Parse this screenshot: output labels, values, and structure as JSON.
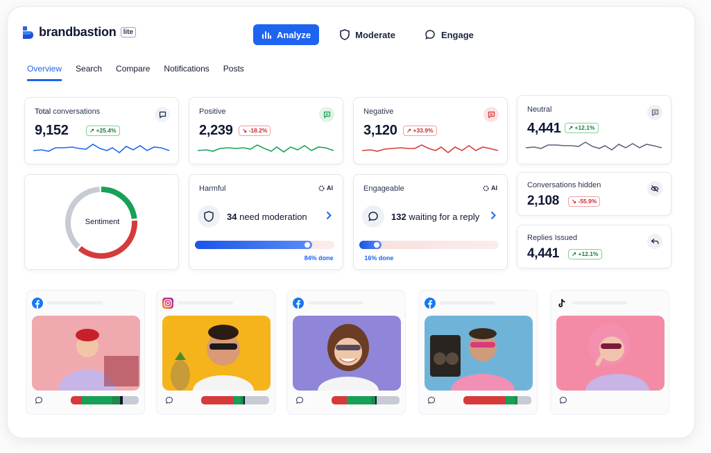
{
  "brand": {
    "name": "brandbastion",
    "badge": "lite"
  },
  "main_nav": [
    {
      "label": "Analyze",
      "active": true,
      "icon": "bar-chart-icon"
    },
    {
      "label": "Moderate",
      "active": false,
      "icon": "shield-icon"
    },
    {
      "label": "Engage",
      "active": false,
      "icon": "chat-bubble-icon"
    }
  ],
  "subtabs": [
    {
      "label": "Overview",
      "active": true
    },
    {
      "label": "Search",
      "active": false
    },
    {
      "label": "Compare",
      "active": false
    },
    {
      "label": "Notifications",
      "active": false
    },
    {
      "label": "Posts",
      "active": false
    }
  ],
  "stats": {
    "total": {
      "title_a": "Total",
      "title_b": "conversations",
      "value": "9,152",
      "delta": "↗ +25.4%"
    },
    "positive": {
      "title": "Positive",
      "value": "2,239",
      "delta": "↘ -18.2%"
    },
    "negative": {
      "title": "Negative",
      "value": "3,120",
      "delta": "↗ +33.9%"
    },
    "neutral": {
      "title": "Neutral",
      "value": "4,441",
      "delta": "↗ +12.1%"
    },
    "hidden": {
      "title": "Conversations hidden",
      "value": "2,108",
      "delta": "↘ -55.9%"
    },
    "replies": {
      "title": "Replies Issued",
      "value": "4,441",
      "delta": "↗ +12.1%"
    }
  },
  "sentiment": {
    "label": "Sentiment",
    "positive_share": 0.24,
    "negative_share": 0.38,
    "neutral_share": 0.38
  },
  "harmful": {
    "title": "Harmful",
    "ai": "AI",
    "count": "34",
    "text": "need moderation",
    "progress": 0.84,
    "done": "84% done"
  },
  "engageable": {
    "title": "Engageable",
    "ai": "AI",
    "count": "132",
    "text": "waiting for a reply",
    "progress": 0.16,
    "done": "16% done"
  },
  "posts": [
    {
      "platform": "facebook-icon",
      "sentiment": [
        0.16,
        0.44,
        0.12,
        0.05,
        0.23
      ]
    },
    {
      "platform": "instagram-icon",
      "sentiment": [
        0.48,
        0.1,
        0.04,
        0.02,
        0.36
      ]
    },
    {
      "platform": "facebook-icon",
      "sentiment": [
        0.22,
        0.36,
        0.06,
        0.02,
        0.34
      ]
    },
    {
      "platform": "facebook-icon",
      "sentiment": [
        0.62,
        0.14,
        0.04,
        0.0,
        0.2
      ]
    },
    {
      "platform": "tiktok-icon",
      "sentiment": []
    }
  ],
  "colors": {
    "accent": "#1e64f0",
    "positive": "#18a058",
    "negative": "#d63a3a",
    "neutral": "#c7cbd3",
    "navy": "#0f1733"
  }
}
